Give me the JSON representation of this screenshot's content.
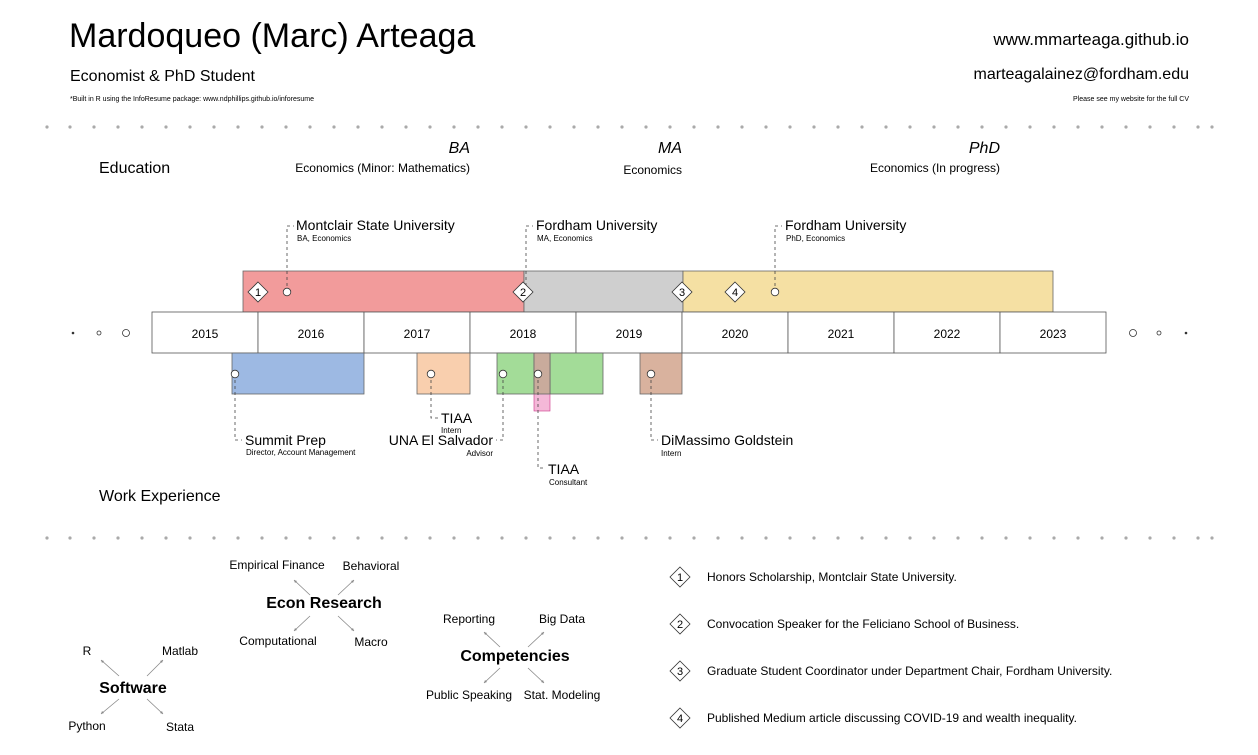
{
  "header": {
    "name": "Mardoqueo (Marc) Arteaga",
    "subtitle": "Economist & PhD Student",
    "footnote": "*Built in R using the InfoResume package: www.ndphillips.github.io/inforesume",
    "website": "www.mmarteaga.github.io",
    "email": "marteagalainez@fordham.edu",
    "cv_note": "Please see my website for the full CV"
  },
  "sections": {
    "education": "Education",
    "work": "Work Experience"
  },
  "degrees": [
    {
      "title": "BA",
      "detail": "Economics (Minor: Mathematics)"
    },
    {
      "title": "MA",
      "detail": "Economics"
    },
    {
      "title": "PhD",
      "detail": "Economics (In progress)"
    }
  ],
  "years": [
    "2015",
    "2016",
    "2017",
    "2018",
    "2019",
    "2020",
    "2021",
    "2022",
    "2023"
  ],
  "education_entries": [
    {
      "school": "Montclair State University",
      "degree": "BA, Economics",
      "color": "#f29b9b"
    },
    {
      "school": "Fordham University",
      "degree": "MA, Economics",
      "color": "#cfcfcf"
    },
    {
      "school": "Fordham University",
      "degree": "PhD, Economics",
      "color": "#f5e0a3"
    }
  ],
  "work_entries": [
    {
      "org": "Summit Prep",
      "role": "Director, Account Management",
      "color": "#9db9e3"
    },
    {
      "org": "TIAA",
      "role": "Intern",
      "color": "#f9cfae"
    },
    {
      "org": "UNA El Salvador",
      "role": "Advisor",
      "color": "#a3dc98"
    },
    {
      "org": "TIAA",
      "role": "Consultant",
      "color": "#c9ab9c"
    },
    {
      "org": "DiMassimo Goldstein",
      "role": "Intern",
      "color": "#d9b29e"
    }
  ],
  "skills": {
    "econ": {
      "title": "Econ Research",
      "items": [
        "Empirical Finance",
        "Behavioral",
        "Computational",
        "Macro"
      ]
    },
    "competencies": {
      "title": "Competencies",
      "items": [
        "Reporting",
        "Big Data",
        "Public Speaking",
        "Stat. Modeling"
      ]
    },
    "software": {
      "title": "Software",
      "items": [
        "R",
        "Matlab",
        "Python",
        "Stata"
      ]
    }
  },
  "awards": [
    {
      "num": "1",
      "text": "Honors Scholarship, Montclair State University."
    },
    {
      "num": "2",
      "text": "Convocation Speaker for the Feliciano School of Business."
    },
    {
      "num": "3",
      "text": "Graduate Student Coordinator under Department Chair, Fordham University."
    },
    {
      "num": "4",
      "text": "Published Medium article discussing COVID-19 and wealth inequality."
    }
  ]
}
